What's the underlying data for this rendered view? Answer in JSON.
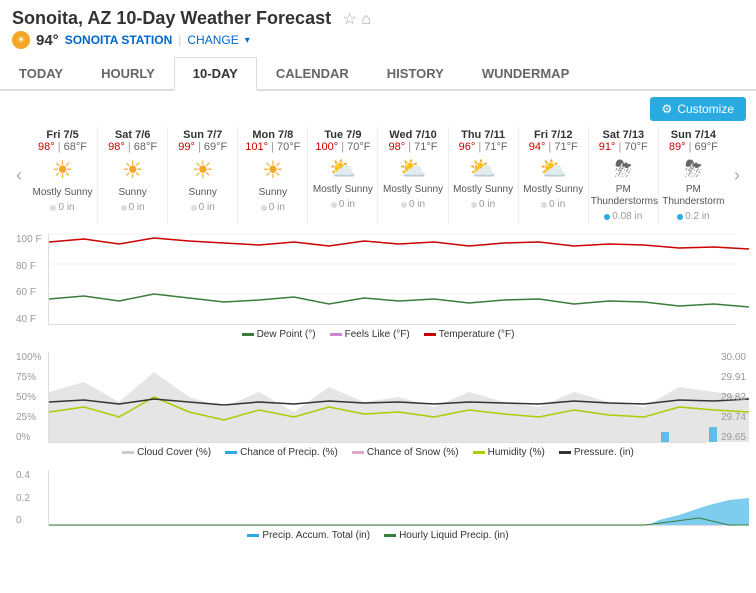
{
  "page": {
    "title": "Sonoita, AZ 10-Day Weather Forecast",
    "station": "SONOITA STATION",
    "change_label": "CHANGE",
    "temp": "94°",
    "temp_unit": "F"
  },
  "nav": {
    "tabs": [
      "TODAY",
      "HOURLY",
      "10-DAY",
      "CALENDAR",
      "HISTORY",
      "WUNDERMAP"
    ],
    "active": "10-DAY"
  },
  "toolbar": {
    "customize_label": "Customize"
  },
  "days": [
    {
      "date": "Fri 7/5",
      "high": "98°",
      "low": "68°F",
      "icon": "☀",
      "desc": "Mostly Sunny",
      "precip": "0 in",
      "has_rain": false
    },
    {
      "date": "Sat 7/6",
      "high": "98°",
      "low": "68°F",
      "icon": "☀",
      "desc": "Sunny",
      "precip": "0 in",
      "has_rain": false
    },
    {
      "date": "Sun 7/7",
      "high": "99°",
      "low": "69°F",
      "icon": "☀",
      "desc": "Sunny",
      "precip": "0 in",
      "has_rain": false
    },
    {
      "date": "Mon 7/8",
      "high": "101°",
      "low": "70°F",
      "icon": "☀",
      "desc": "Sunny",
      "precip": "0 in",
      "has_rain": false
    },
    {
      "date": "Tue 7/9",
      "high": "100°",
      "low": "70°F",
      "icon": "⛅",
      "desc": "Mostly Sunny",
      "precip": "0 in",
      "has_rain": false
    },
    {
      "date": "Wed 7/10",
      "high": "98°",
      "low": "71°F",
      "icon": "⛅",
      "desc": "Mostly Sunny",
      "precip": "0 in",
      "has_rain": false
    },
    {
      "date": "Thu 7/11",
      "high": "96°",
      "low": "71°F",
      "icon": "⛅",
      "desc": "Mostly Sunny",
      "precip": "0 in",
      "has_rain": false
    },
    {
      "date": "Fri 7/12",
      "high": "94°",
      "low": "71°F",
      "icon": "⛅",
      "desc": "Mostly Sunny",
      "precip": "0 in",
      "has_rain": false
    },
    {
      "date": "Sat 7/13",
      "high": "91°",
      "low": "70°F",
      "icon": "⛈",
      "desc": "PM Thunderstorms",
      "precip": "0.08 in",
      "has_rain": true
    },
    {
      "date": "Sun 7/14",
      "high": "89°",
      "low": "69°F",
      "icon": "⛈",
      "desc": "PM Thunderstorm",
      "precip": "0.2 in",
      "has_rain": true
    }
  ],
  "chart1": {
    "y_labels": [
      "100 F",
      "80 F",
      "60 F",
      "40 F"
    ],
    "legend": [
      {
        "label": "Dew Point (°)",
        "color": "#3a7d3a"
      },
      {
        "label": "Feels Like (°F)",
        "color": "#cc88cc"
      },
      {
        "label": "Temperature (°F)",
        "color": "#cc0000"
      }
    ]
  },
  "chart2": {
    "y_labels": [
      "100%",
      "75%",
      "50%",
      "25%",
      "0%"
    ],
    "y_right": [
      "30.00",
      "29.91",
      "29.82",
      "29.74",
      "29.65"
    ],
    "legend": [
      {
        "label": "Cloud Cover (%)",
        "color": "#cccccc"
      },
      {
        "label": "Chance of Precip. (%)",
        "color": "#29abe2"
      },
      {
        "label": "Chance of Snow (%)",
        "color": "#ddaacc"
      },
      {
        "label": "Humidity (%)",
        "color": "#aacc00"
      },
      {
        "label": "Pressure. (in)",
        "color": "#333333"
      }
    ]
  },
  "chart3": {
    "y_labels": [
      "0.4",
      "0.2",
      "0"
    ],
    "legend": [
      {
        "label": "Precip. Accum. Total (in)",
        "color": "#29abe2"
      },
      {
        "label": "Hourly Liquid Precip. (in)",
        "color": "#3a7d3a"
      }
    ]
  }
}
